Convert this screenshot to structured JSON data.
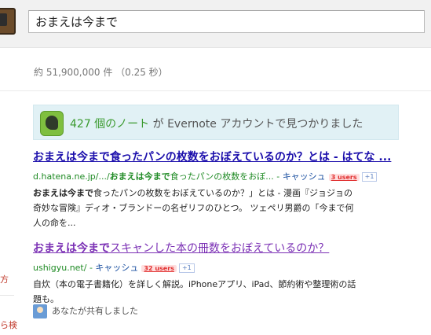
{
  "search": {
    "query": "おまえは今まで"
  },
  "stats": "約 51,900,000 件 （0.25 秒）",
  "evernote": {
    "count": "427 個のノート",
    "middle": " が ",
    "brand": "Evernote",
    "suffix": " アカウントで見つかりました"
  },
  "results": [
    {
      "title_bold": "おまえは今まで",
      "title_rest": "食ったパンの枚数をおぼえているのか？とは - はてな ...",
      "url_prefix": "d.hatena.ne.jp/.../",
      "url_bold": "おまえは今まで",
      "url_rest": "食ったパンの枚数をおぼ...",
      "url_sep": " - ",
      "cache": "キャッシュ",
      "users": "3 users",
      "plus": "+1",
      "snippet_bold": "おまえは今まで",
      "snippet_rest": "食ったパンの枚数をおぼえているのか？」とは - 漫画『ジョジョの奇妙な冒険』ディオ・ブランドーの名ゼリフのひとつ。 ツェペリ男爵の「今まで何人の命を..."
    },
    {
      "title_bold": "おまえは今まで",
      "title_rest": "スキャンした本の冊数をおぼえているのか？",
      "url_prefix": "ushigyu.net/",
      "url_sep": " - ",
      "cache": "キャッシュ",
      "users": "32 users",
      "plus": "+1",
      "snippet": "自炊（本の電子書籍化）を詳しく解説。iPhoneアプリ、iPad、節約術や整理術の話題も。"
    }
  ],
  "shared": "あなたが共有しました",
  "left_fragments": [
    "方",
    "ら検"
  ]
}
